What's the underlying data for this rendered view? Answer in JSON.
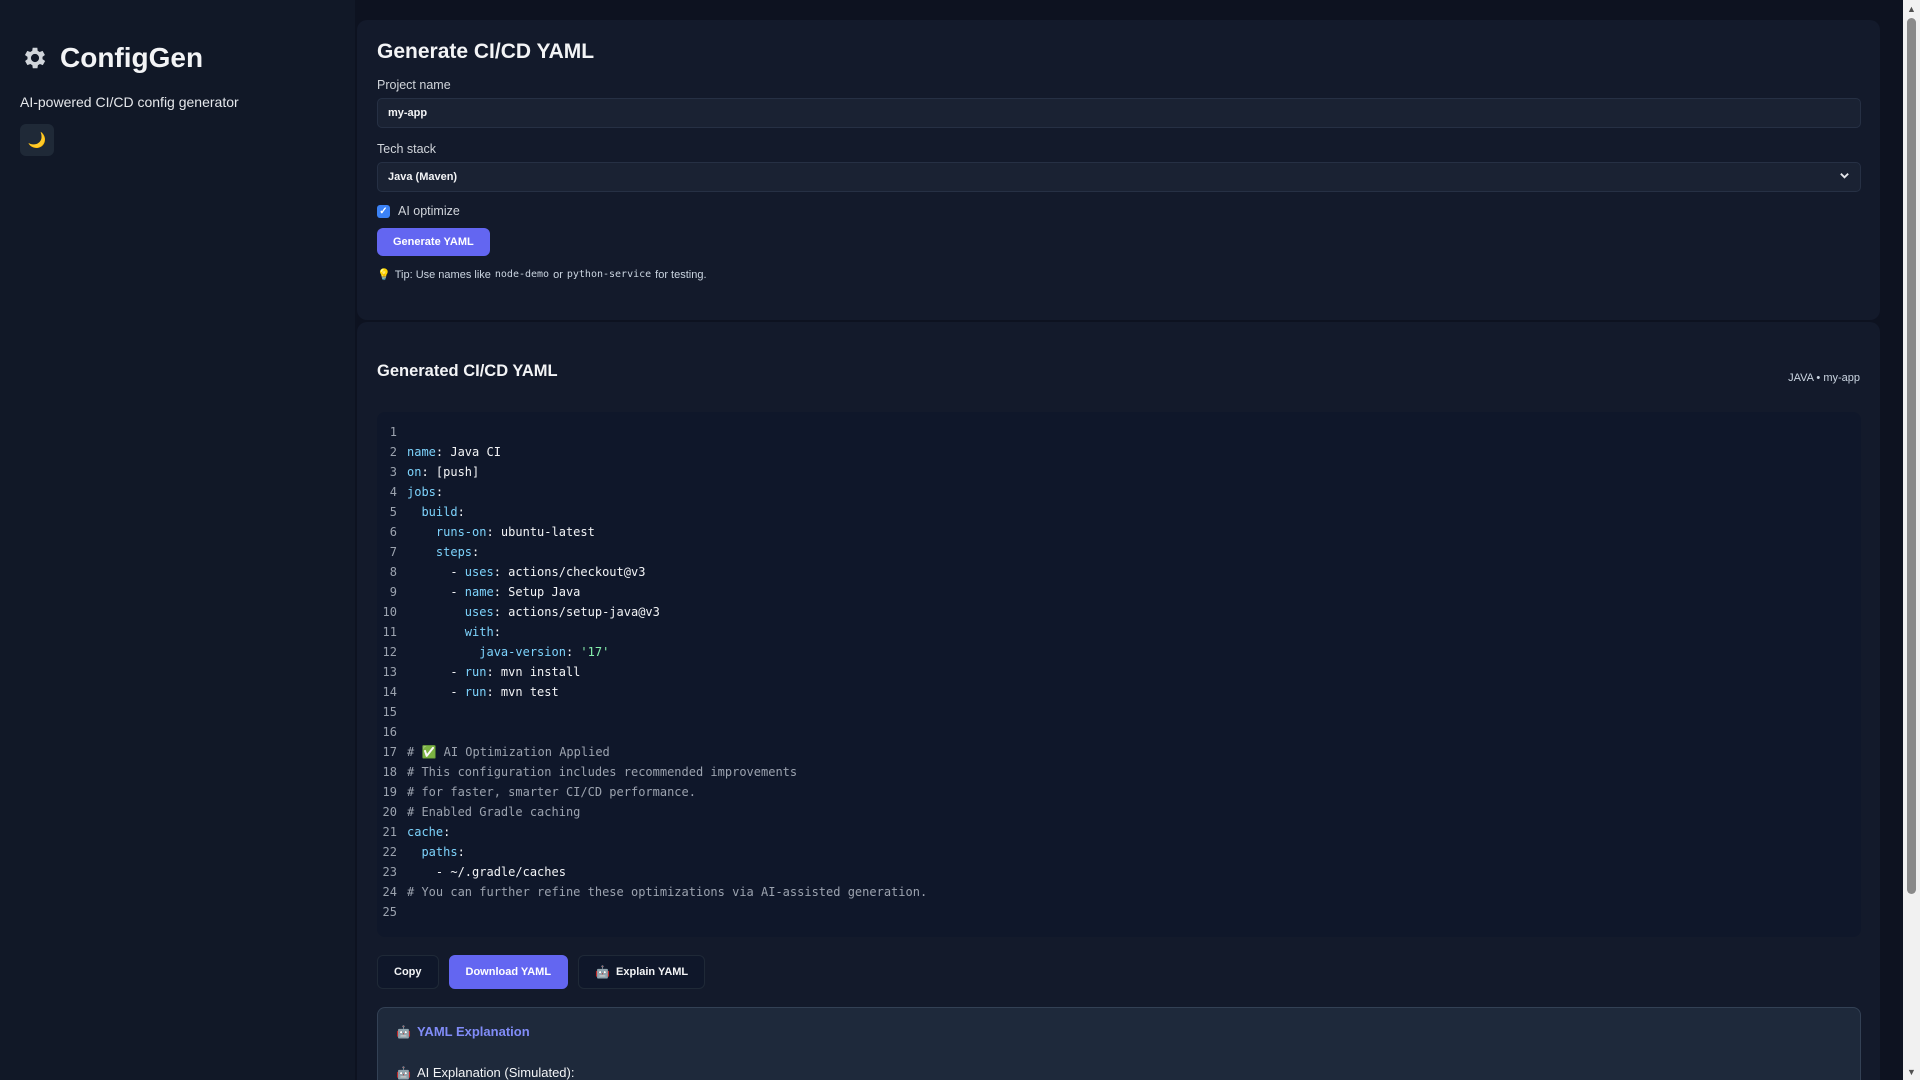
{
  "sidebar": {
    "title": "ConfigGen",
    "subtitle": "AI-powered CI/CD config generator",
    "theme_toggle_icon": "moon-icon"
  },
  "form": {
    "heading": "Generate CI/CD YAML",
    "project_label": "Project name",
    "project_value": "my-app",
    "stack_label": "Tech stack",
    "stack_value": "Java (Maven)",
    "ai_label": "AI optimize",
    "ai_checked": true,
    "generate_label": "Generate YAML",
    "tip_prefix": "Tip: Use names like ",
    "tip_code1": "node-demo",
    "tip_mid": " or ",
    "tip_code2": "python-service",
    "tip_suffix": " for testing."
  },
  "output": {
    "heading": "Generated CI/CD YAML",
    "meta": "JAVA • my-app",
    "lines": [
      "",
      "name: Java CI",
      "on: [push]",
      "jobs:",
      "  build:",
      "    runs-on: ubuntu-latest",
      "    steps:",
      "      - uses: actions/checkout@v3",
      "      - name: Setup Java",
      "        uses: actions/setup-java@v3",
      "        with:",
      "          java-version: '17'",
      "      - run: mvn install",
      "      - run: mvn test",
      "",
      "",
      "# ✅ AI Optimization Applied",
      "# This configuration includes recommended improvements",
      "# for faster, smarter CI/CD performance.",
      "# Enabled Gradle caching",
      "cache:",
      "  paths:",
      "    - ~/.gradle/caches",
      "# You can further refine these optimizations via AI-assisted generation.",
      ""
    ],
    "copy_label": "Copy",
    "download_label": "Download YAML",
    "explain_label": "Explain YAML"
  },
  "explanation": {
    "title": "YAML Explanation",
    "subtitle": "AI Explanation (Simulated):"
  },
  "colors": {
    "accent": "#6366f1",
    "background": "#0d1220",
    "card": "#131a2b"
  }
}
